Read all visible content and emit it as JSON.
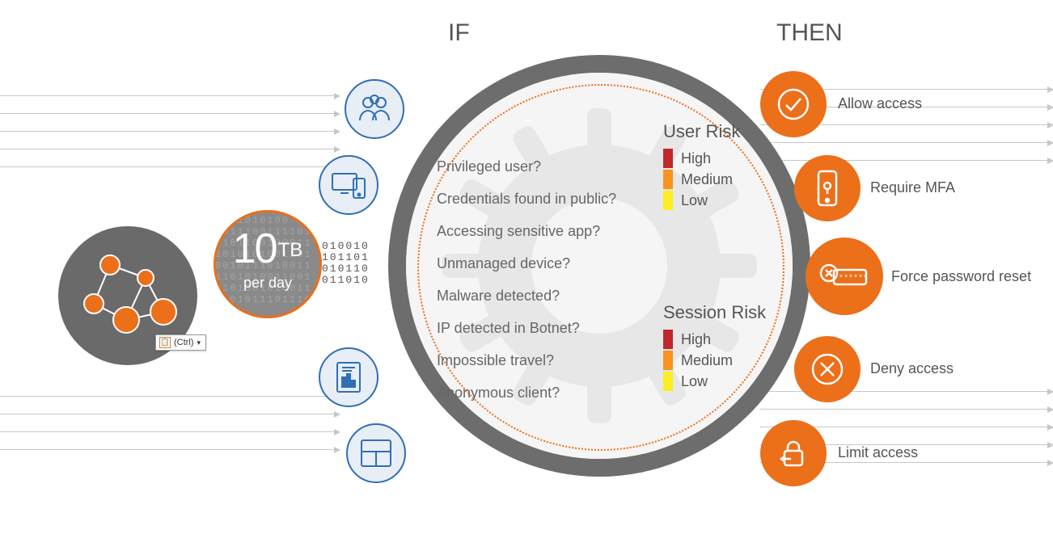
{
  "headings": {
    "if": "IF",
    "then": "THEN"
  },
  "data_volume": {
    "value": "10",
    "unit": "TB",
    "sub": "per day"
  },
  "ctrl_popup": "(Ctrl)",
  "conditions": [
    "Privileged user?",
    "Credentials found in public?",
    "Accessing sensitive app?",
    "Unmanaged device?",
    "Malware detected?",
    "IP detected in Botnet?",
    "Impossible travel?",
    "Anonymous client?"
  ],
  "risk": {
    "user": {
      "title": "User Risk",
      "levels": [
        {
          "label": "High",
          "color": "#c1272d"
        },
        {
          "label": "Medium",
          "color": "#f7931e"
        },
        {
          "label": "Low",
          "color": "#fcee21"
        }
      ]
    },
    "session": {
      "title": "Session Risk",
      "levels": [
        {
          "label": "High",
          "color": "#c1272d"
        },
        {
          "label": "Medium",
          "color": "#f7931e"
        },
        {
          "label": "Low",
          "color": "#fcee21"
        }
      ]
    }
  },
  "actions": [
    {
      "label": "Allow access"
    },
    {
      "label": "Require MFA"
    },
    {
      "label": "Force password reset"
    },
    {
      "label": "Deny access"
    },
    {
      "label": "Limit access"
    }
  ],
  "colors": {
    "orange": "#ec6f1a",
    "blue": "#2f6fb5",
    "grey": "#6d6d6d"
  },
  "icons": {
    "cond": [
      "users-icon",
      "devices-icon",
      "report-icon",
      "layout-icon"
    ],
    "act": [
      "check-icon",
      "mfa-phone-icon",
      "password-reset-icon",
      "deny-icon",
      "lock-limit-icon"
    ]
  }
}
